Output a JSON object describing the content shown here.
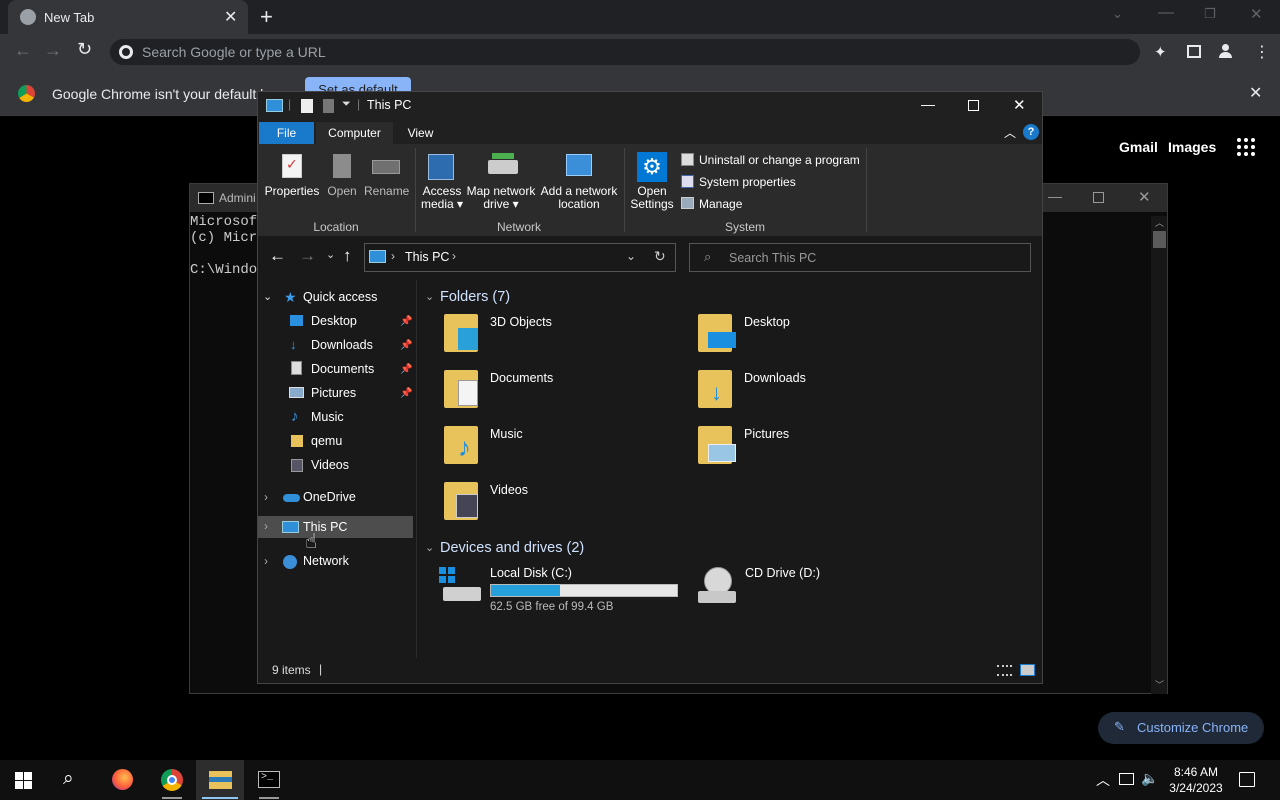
{
  "chrome": {
    "tab_title": "New Tab",
    "omnibox_placeholder": "Search Google or type a URL",
    "infobar_text": "Google Chrome isn't your default br",
    "infobar_button": "Set as default",
    "links": [
      "Gmail",
      "Images"
    ],
    "customize_label": "Customize Chrome"
  },
  "cmd": {
    "title": "Admini",
    "lines": [
      "Microsoft",
      "(c) Micro",
      "",
      "C:\\Window"
    ]
  },
  "explorer": {
    "title": "This PC",
    "tabs": {
      "file": "File",
      "computer": "Computer",
      "view": "View"
    },
    "ribbon": {
      "location": {
        "group": "Location",
        "properties": "Properties",
        "open": "Open",
        "rename": "Rename"
      },
      "network": {
        "group": "Network",
        "access_media_1": "Access",
        "access_media_2": "media",
        "map_drive_1": "Map network",
        "map_drive_2": "drive",
        "add_location_1": "Add a network",
        "add_location_2": "location"
      },
      "system": {
        "group": "System",
        "open_settings_1": "Open",
        "open_settings_2": "Settings",
        "uninstall": "Uninstall or change a program",
        "sys_props": "System properties",
        "manage": "Manage"
      }
    },
    "address": {
      "crumb": "This PC",
      "search_placeholder": "Search This PC"
    },
    "nav": {
      "quick_access": "Quick access",
      "items": [
        "Desktop",
        "Downloads",
        "Documents",
        "Pictures",
        "Music",
        "qemu",
        "Videos"
      ],
      "onedrive": "OneDrive",
      "this_pc": "This PC",
      "network": "Network"
    },
    "folders_header": "Folders (7)",
    "folders": [
      "3D Objects",
      "Desktop",
      "Documents",
      "Downloads",
      "Music",
      "Pictures",
      "Videos"
    ],
    "drives_header": "Devices and drives (2)",
    "drives": [
      {
        "name": "Local Disk (C:)",
        "free": "62.5 GB free of 99.4 GB",
        "used_fraction": 0.37
      },
      {
        "name": "CD Drive (D:)"
      }
    ],
    "status": "9 items"
  },
  "taskbar": {
    "time": "8:46 AM",
    "date": "3/24/2023"
  },
  "colors": {
    "accent": "#0078d4",
    "ribbon_file": "#1979ca",
    "selection": "#4d4d4d",
    "folder": "#e8c25b"
  }
}
